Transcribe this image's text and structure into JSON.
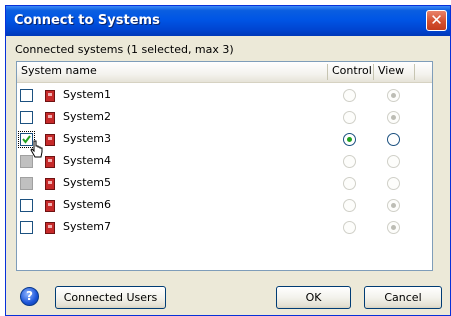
{
  "window": {
    "title": "Connect to Systems",
    "close_glyph": "✕"
  },
  "caption": "Connected systems (1 selected, max 3)",
  "columns": {
    "name": "System name",
    "control": "Control",
    "view": "View"
  },
  "rows": [
    {
      "label": "System1",
      "checkbox": "unchecked",
      "control": "off-disabled",
      "view": "on-disabled"
    },
    {
      "label": "System2",
      "checkbox": "unchecked",
      "control": "off-disabled",
      "view": "on-disabled"
    },
    {
      "label": "System3",
      "checkbox": "checked",
      "control": "on",
      "view": "off"
    },
    {
      "label": "System4",
      "checkbox": "disabled",
      "control": "off-disabled",
      "view": "off-disabled"
    },
    {
      "label": "System5",
      "checkbox": "disabled",
      "control": "off-disabled",
      "view": "off-disabled"
    },
    {
      "label": "System6",
      "checkbox": "unchecked",
      "control": "off-disabled",
      "view": "on-disabled"
    },
    {
      "label": "System7",
      "checkbox": "unchecked",
      "control": "off-disabled",
      "view": "on-disabled"
    }
  ],
  "buttons": {
    "help_glyph": "?",
    "connected_users": "Connected Users",
    "ok": "OK",
    "cancel": "Cancel"
  },
  "icons": {
    "system": "system-icon",
    "help": "help-icon",
    "cursor": "hand-cursor-icon"
  }
}
